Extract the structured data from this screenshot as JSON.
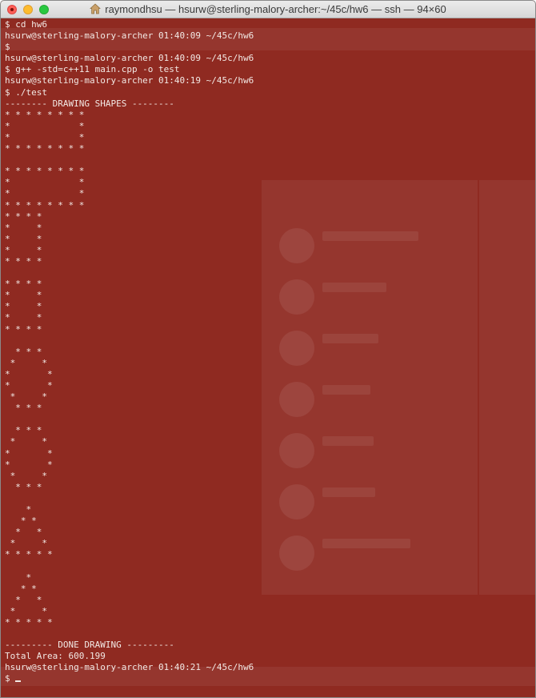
{
  "window": {
    "title": "raymondhsu — hsurw@sterling-malory-archer:~/45c/hw6 — ssh — 94×60"
  },
  "terminal": {
    "lines": [
      "$ cd hw6",
      "hsurw@sterling-malory-archer 01:40:09 ~/45c/hw6",
      "$",
      "hsurw@sterling-malory-archer 01:40:09 ~/45c/hw6",
      "$ g++ -std=c++11 main.cpp -o test",
      "hsurw@sterling-malory-archer 01:40:19 ~/45c/hw6",
      "$ ./test",
      "-------- DRAWING SHAPES --------",
      "* * * * * * * *",
      "*             *",
      "*             *",
      "* * * * * * * *",
      "",
      "* * * * * * * *",
      "*             *",
      "*             *",
      "* * * * * * * *",
      "* * * *",
      "*     *",
      "*     *",
      "*     *",
      "* * * *",
      "",
      "* * * *",
      "*     *",
      "*     *",
      "*     *",
      "* * * *",
      "",
      "  * * *",
      " *     *",
      "*       *",
      "*       *",
      " *     *",
      "  * * *",
      "",
      "  * * *",
      " *     *",
      "*       *",
      "*       *",
      " *     *",
      "  * * *",
      "",
      "    *",
      "   * *",
      "  *   *",
      " *     *",
      "* * * * *",
      "",
      "    *",
      "   * *",
      "  *   *",
      " *     *",
      "* * * * *",
      "",
      "--------- DONE DRAWING ---------",
      "Total Area: 600.199",
      "hsurw@sterling-malory-archer 01:40:21 ~/45c/hw6",
      "$ "
    ]
  },
  "colors": {
    "terminal_background": "#8f2a21",
    "terminal_text": "#f2e8e4"
  }
}
